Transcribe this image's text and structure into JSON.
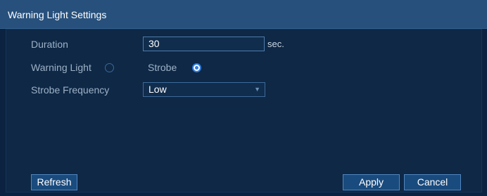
{
  "window": {
    "title": "Warning Light Settings"
  },
  "form": {
    "duration_label": "Duration",
    "duration_value": "30",
    "duration_unit": "sec.",
    "warning_light_label": "Warning Light",
    "warning_light_selected": false,
    "strobe_label": "Strobe",
    "strobe_selected": true,
    "strobe_frequency_label": "Strobe Frequency",
    "strobe_frequency_value": "Low"
  },
  "buttons": {
    "refresh": "Refresh",
    "apply": "Apply",
    "cancel": "Cancel"
  },
  "icons": {
    "dropdown": "chevron-down-icon"
  },
  "colors": {
    "title_bar": "#27507c",
    "background": "#0b2340",
    "accent": "#2f7de1"
  }
}
